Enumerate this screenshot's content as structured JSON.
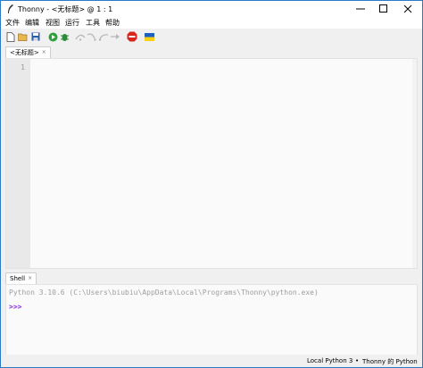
{
  "window": {
    "app_name": "Thonny",
    "separator": "-",
    "file_name": "<无标题>",
    "at": "@",
    "cursor_pos": "1 : 1"
  },
  "menu": [
    "文件",
    "编辑",
    "视图",
    "运行",
    "工具",
    "帮助"
  ],
  "toolbar": {
    "icons": [
      "new-file-icon",
      "open-file-icon",
      "save-icon",
      "run-icon",
      "debug-icon",
      "step-over-icon",
      "step-into-icon",
      "step-out-icon",
      "resume-icon",
      "stop-icon",
      "ukraine-flag-icon"
    ]
  },
  "editor": {
    "tab_label": "<无标题>",
    "tab_close": "×",
    "line_number": "1"
  },
  "shell": {
    "tab_label": "Shell",
    "tab_close": "×",
    "banner": "Python 3.10.6 (C:\\Users\\biubiu\\AppData\\Local\\Programs\\Thonny\\python.exe)",
    "prompt": ">>>"
  },
  "status": {
    "interpreter": "Local Python 3",
    "bullet": "•",
    "python_label": "Thonny 的 Python"
  },
  "colors": {
    "accent_blue": "#2c7bc6",
    "prompt_purple": "#8a2be2",
    "banner_gray": "#9e9e9e",
    "stop_red": "#d9261c",
    "run_green": "#2ea23a"
  }
}
